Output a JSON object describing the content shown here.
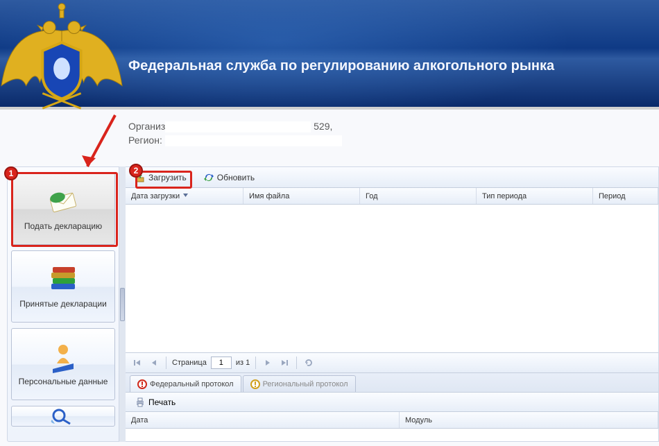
{
  "header": {
    "title": "Федеральная служба по регулированию алкогольного рынка"
  },
  "info": {
    "org_label": "Организ",
    "org_suffix": "529,",
    "region_label": "Регион:"
  },
  "sidebar": {
    "items": [
      {
        "label": "Подать декларацию",
        "icon": "envelope"
      },
      {
        "label": "Принятые декларации",
        "icon": "books"
      },
      {
        "label": "Персональные данные",
        "icon": "person"
      },
      {
        "label": "",
        "icon": "magnifier"
      }
    ]
  },
  "toolbar": {
    "upload": "Загрузить",
    "refresh": "Обновить"
  },
  "columns1": {
    "date": "Дата загрузки",
    "filename": "Имя файла",
    "year": "Год",
    "period_type": "Тип периода",
    "period": "Период"
  },
  "paging": {
    "page_label": "Страница",
    "page_value": "1",
    "total_label": "из 1"
  },
  "tabs": {
    "federal": "Федеральный протокол",
    "regional": "Региональный протокол"
  },
  "lower_toolbar": {
    "print": "Печать"
  },
  "columns2": {
    "date": "Дата",
    "module": "Модуль"
  },
  "annotations": {
    "badge1": "1",
    "badge2": "2"
  }
}
